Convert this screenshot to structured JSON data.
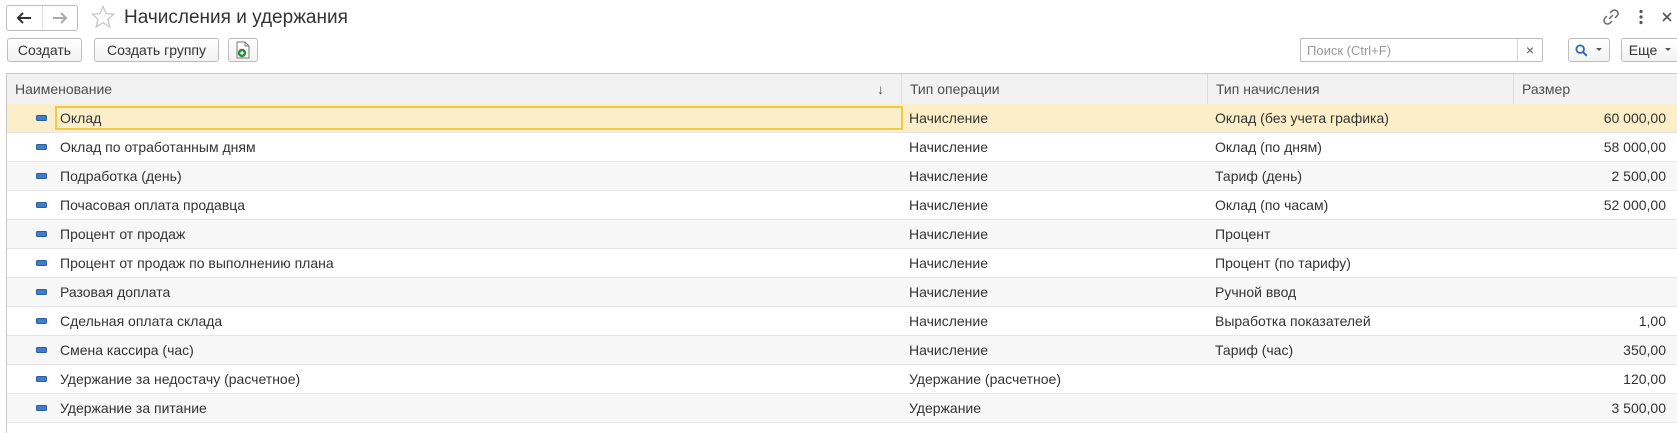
{
  "window": {
    "title": "Начисления и удержания"
  },
  "toolbar": {
    "create_label": "Создать",
    "create_group_label": "Создать группу",
    "search_placeholder": "Поиск (Ctrl+F)",
    "search_clear": "×",
    "more_label": "Еще"
  },
  "table": {
    "columns": [
      "Наименование",
      "Тип операции",
      "Тип начисления",
      "Размер"
    ],
    "sort_indicator": "↓",
    "rows": [
      {
        "name": "Оклад",
        "operation": "Начисление",
        "accrual_type": "Оклад (без учета графика)",
        "size": "60 000,00",
        "selected": true
      },
      {
        "name": "Оклад по отработанным дням",
        "operation": "Начисление",
        "accrual_type": "Оклад (по дням)",
        "size": "58 000,00"
      },
      {
        "name": "Подработка (день)",
        "operation": "Начисление",
        "accrual_type": "Тариф (день)",
        "size": "2 500,00"
      },
      {
        "name": "Почасовая оплата продавца",
        "operation": "Начисление",
        "accrual_type": "Оклад (по часам)",
        "size": "52 000,00"
      },
      {
        "name": "Процент от продаж",
        "operation": "Начисление",
        "accrual_type": "Процент",
        "size": ""
      },
      {
        "name": "Процент от продаж по выполнению плана",
        "operation": "Начисление",
        "accrual_type": "Процент (по тарифу)",
        "size": ""
      },
      {
        "name": "Разовая доплата",
        "operation": "Начисление",
        "accrual_type": "Ручной ввод",
        "size": ""
      },
      {
        "name": "Сдельная оплата склада",
        "operation": "Начисление",
        "accrual_type": "Выработка показателей",
        "size": "1,00"
      },
      {
        "name": "Смена кассира (час)",
        "operation": "Начисление",
        "accrual_type": "Тариф (час)",
        "size": "350,00"
      },
      {
        "name": "Удержание за недостачу (расчетное)",
        "operation": "Удержание (расчетное)",
        "accrual_type": "",
        "size": "120,00"
      },
      {
        "name": "Удержание за питание",
        "operation": "Удержание",
        "accrual_type": "",
        "size": "3 500,00"
      }
    ]
  },
  "colors": {
    "selected_row": "#fbeec8",
    "focus_border": "#f2c84a",
    "row_icon": "#3f7ecb",
    "search_icon": "#2b6cb0",
    "excel_icon": "#2e8b3d"
  }
}
